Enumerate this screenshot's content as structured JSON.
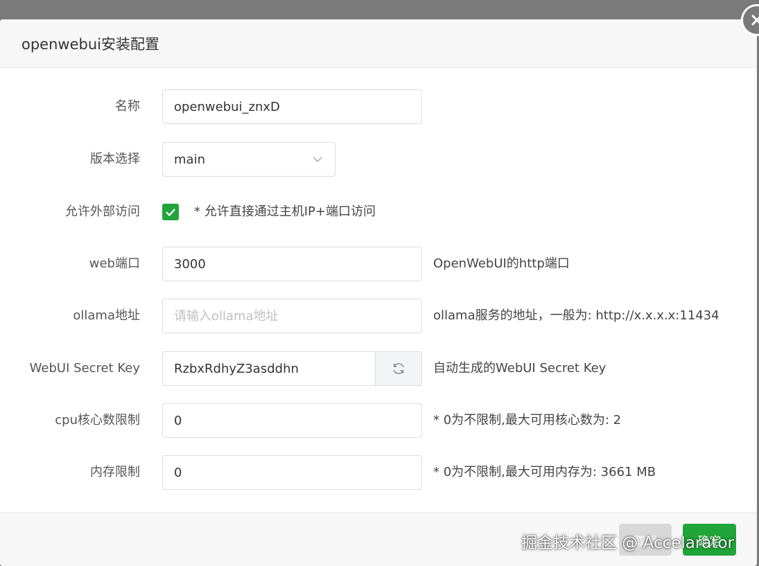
{
  "dialog": {
    "title": "openwebui安装配置"
  },
  "form": {
    "name": {
      "label": "名称",
      "value": "openwebui_znxD"
    },
    "version": {
      "label": "版本选择",
      "value": "main"
    },
    "external_access": {
      "label": "允许外部访问",
      "checked": true,
      "text": "* 允许直接通过主机IP+端口访问"
    },
    "web_port": {
      "label": "web端口",
      "value": "3000",
      "hint": "OpenWebUI的http端口"
    },
    "ollama_address": {
      "label": "ollama地址",
      "value": "",
      "placeholder": "请输入ollama地址",
      "hint": "ollama服务的地址，一般为: http://x.x.x.x:11434"
    },
    "secret_key": {
      "label": "WebUI Secret Key",
      "value": "RzbxRdhyZ3asddhn",
      "hint": "自动生成的WebUI Secret Key"
    },
    "cpu_limit": {
      "label": "cpu核心数限制",
      "value": "0",
      "hint": "* 0为不限制,最大可用核心数为: 2"
    },
    "memory_limit": {
      "label": "内存限制",
      "value": "0",
      "hint": "* 0为不限制,最大可用内存为: 3661 MB"
    }
  },
  "footer": {
    "cancel_label": "取消",
    "confirm_label": "确定"
  },
  "watermark": "掘金技术社区 @ Accelarator",
  "colors": {
    "accent": "#20a53a",
    "overlay": "#7a7a7a"
  },
  "icons": {
    "close": "close-icon",
    "chevron": "chevron-down-icon",
    "check": "check-icon",
    "refresh": "refresh-icon"
  }
}
